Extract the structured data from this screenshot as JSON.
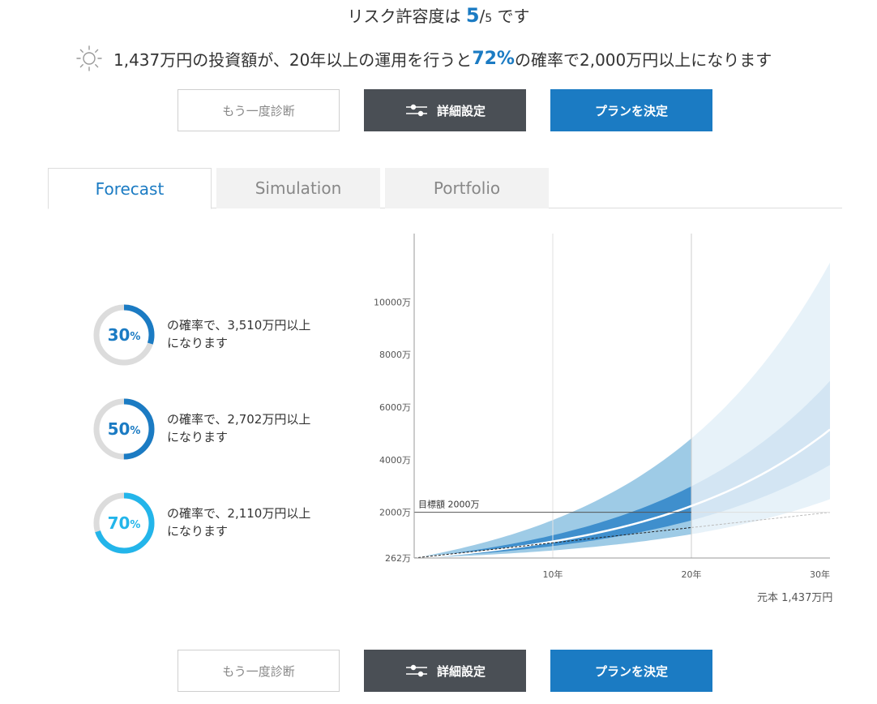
{
  "header": {
    "risk_prefix": "リスク許容度は",
    "risk_value": "5",
    "risk_sep": "/",
    "risk_max": "5",
    "risk_suffix": "です"
  },
  "summary": {
    "part1": "1,437万円の投資額が、20年以上の運用を行うと",
    "highlight": "72%",
    "part2": "の確率で2,000万円以上になります",
    "icon": "sun-icon"
  },
  "buttons": {
    "retry": "もう一度診断",
    "detail": "詳細設定",
    "plan": "プランを決定",
    "detail_icon": "sliders-icon"
  },
  "tabs": [
    {
      "label": "Forecast",
      "active": true
    },
    {
      "label": "Simulation",
      "active": false
    },
    {
      "label": "Portfolio",
      "active": false
    }
  ],
  "probabilities": [
    {
      "value": "30",
      "unit": "%",
      "fraction": 0.3,
      "color": "#1b7bc3",
      "line1": "の確率で、3,510万円以上",
      "line2": "になります"
    },
    {
      "value": "50",
      "unit": "%",
      "fraction": 0.5,
      "color": "#1b7bc3",
      "line1": "の確率で、2,702万円以上",
      "line2": "になります"
    },
    {
      "value": "70",
      "unit": "%",
      "fraction": 0.7,
      "color": "#23b5ea",
      "line1": "の確率で、2,110万円以上",
      "line2": "になります"
    }
  ],
  "chart_data": {
    "type": "area",
    "y_tick_labels": [
      "262万",
      "2000万",
      "4000万",
      "6000万",
      "8000万",
      "10000万"
    ],
    "y_ticks": [
      262,
      2000,
      4000,
      6000,
      8000,
      10000
    ],
    "x_tick_labels": [
      "10年",
      "20年",
      "30年"
    ],
    "x_ticks": [
      10,
      20,
      30
    ],
    "xlim": [
      0,
      30
    ],
    "ylim": [
      262,
      12600
    ],
    "target_label": "目標額 2000万",
    "target_value": 2000,
    "highlight_until_year": 20,
    "start_value": 262,
    "end_values": {
      "median": 5150,
      "inner_upper": 7000,
      "inner_lower": 3800,
      "outer_upper": 11500,
      "outer_lower": 2500,
      "principal": 2000
    },
    "principal_label": "元本 1,437万円",
    "colors": {
      "outer_band": "#9ecbe6",
      "inner_band": "#3f8fcd",
      "median": "#ffffff",
      "axis": "#999999",
      "target_line": "#555555"
    }
  }
}
